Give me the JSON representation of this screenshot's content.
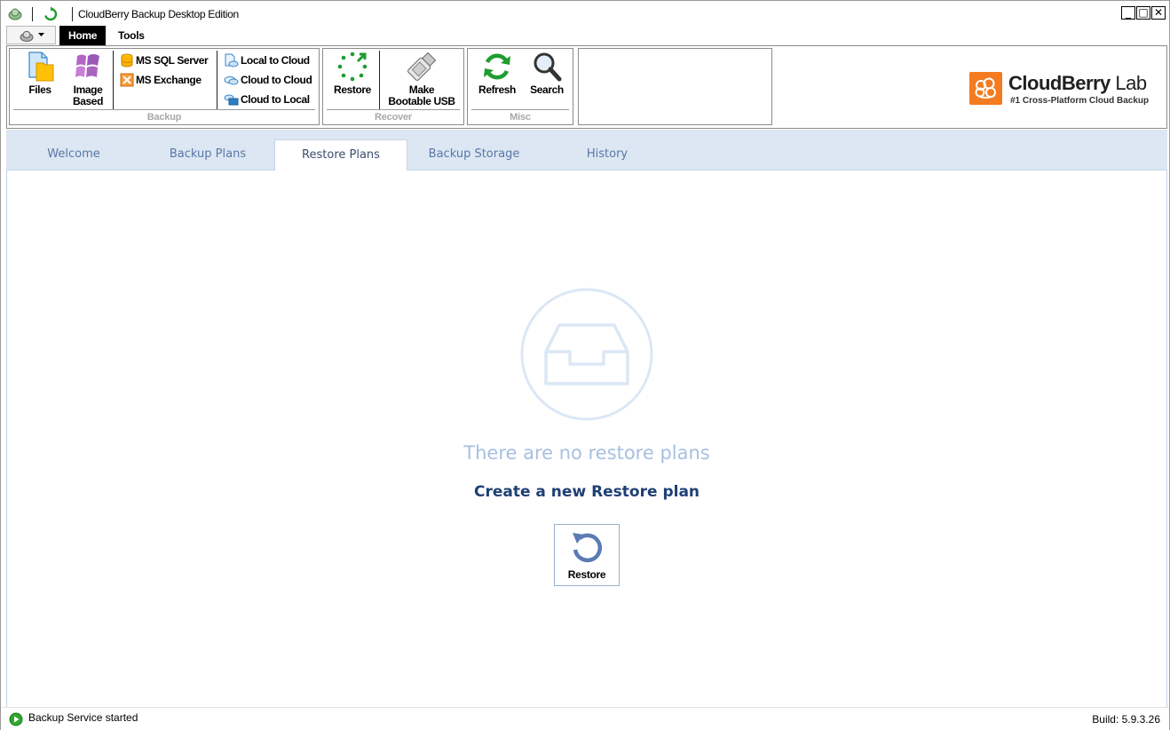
{
  "window": {
    "title": "CloudBerry Backup Desktop Edition",
    "controls": {
      "minimize": "_",
      "maximize": "□",
      "close": "✕"
    }
  },
  "menu": {
    "tabs": [
      "Home",
      "Tools"
    ],
    "active_tab": "Home"
  },
  "ribbon": {
    "groups": {
      "backup": {
        "label": "Backup",
        "files": "Files",
        "image_based_line1": "Image",
        "image_based_line2": "Based",
        "ms_sql": "MS SQL Server",
        "ms_exchange": "MS Exchange",
        "local_to_cloud": "Local to Cloud",
        "cloud_to_cloud": "Cloud to Cloud",
        "cloud_to_local": "Cloud to Local"
      },
      "recover": {
        "label": "Recover",
        "restore": "Restore",
        "usb_line1": "Make",
        "usb_line2": "Bootable USB"
      },
      "misc": {
        "label": "Misc",
        "refresh": "Refresh",
        "search": "Search"
      }
    },
    "brand": {
      "name": "CloudBerry",
      "suffix": "Lab",
      "tagline": "#1 Cross-Platform Cloud Backup",
      "color": "#f47b20"
    }
  },
  "tabs": {
    "items": [
      "Welcome",
      "Backup Plans",
      "Restore Plans",
      "Backup Storage",
      "History"
    ],
    "active": "Restore Plans"
  },
  "content": {
    "empty_message": "There are no restore plans",
    "create_link": "Create a new Restore plan",
    "restore_button": "Restore"
  },
  "status": {
    "message": "Backup Service started",
    "build": "Build: 5.9.3.26"
  },
  "colors": {
    "accent_blue": "#1f3f74",
    "tab_strip": "#dce7f3",
    "empty_text": "#a7c0e0",
    "ok_green": "#2ea82e"
  }
}
